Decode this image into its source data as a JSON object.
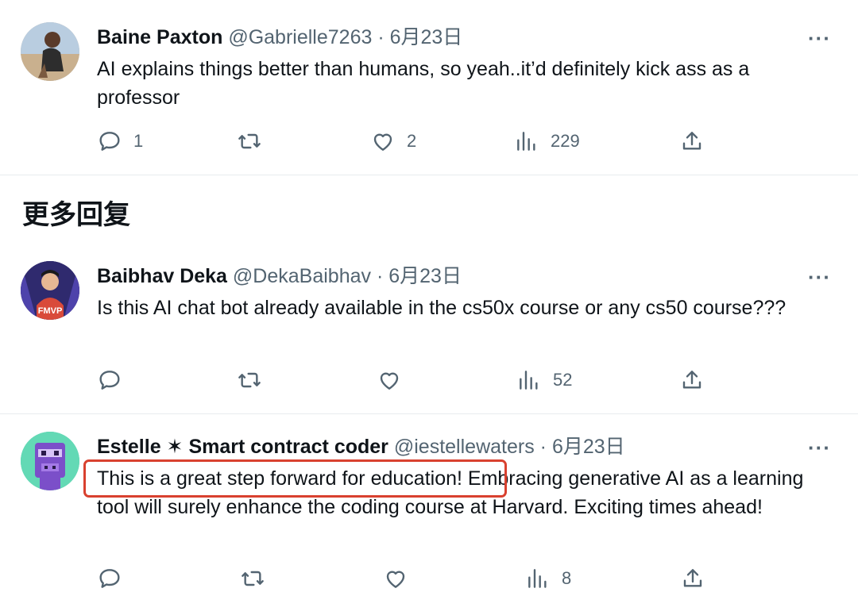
{
  "section_title": "更多回复",
  "tweets": [
    {
      "name": "Baine Paxton",
      "handle": "@Gabrielle7263",
      "date": "· 6月23日",
      "more": "···",
      "text": "AI explains things better than humans, so yeah..it’d definitely kick ass as a professor",
      "actions": {
        "reply": "1",
        "retweet": "",
        "like": "2",
        "views": "229"
      }
    },
    {
      "name": "Baibhav Deka",
      "handle": "@DekaBaibhav",
      "date": "· 6月23日",
      "more": "···",
      "text": "Is this AI chat bot already available in the cs50x course or any cs50 course???",
      "actions": {
        "reply": "",
        "retweet": "",
        "like": "",
        "views": "52"
      }
    },
    {
      "name": "Estelle ✶ Smart contract coder",
      "handle": "@iestellewaters",
      "date": "· 6月23日",
      "more": "···",
      "text_highlight": "This is a great step forward for education!",
      "text_rest": " Embracing generative AI as a learning tool will surely enhance the coding course at Harvard. Exciting times ahead!",
      "actions": {
        "reply": "",
        "retweet": "",
        "like": "",
        "views": "8"
      }
    }
  ],
  "avatar2_caption": "FMVP",
  "colors": {
    "accent_highlight": "#d9412f",
    "muted": "#536471",
    "text": "#0f1419"
  },
  "icons": [
    "reply-icon",
    "retweet-icon",
    "like-icon",
    "views-icon",
    "share-icon",
    "more-icon"
  ]
}
